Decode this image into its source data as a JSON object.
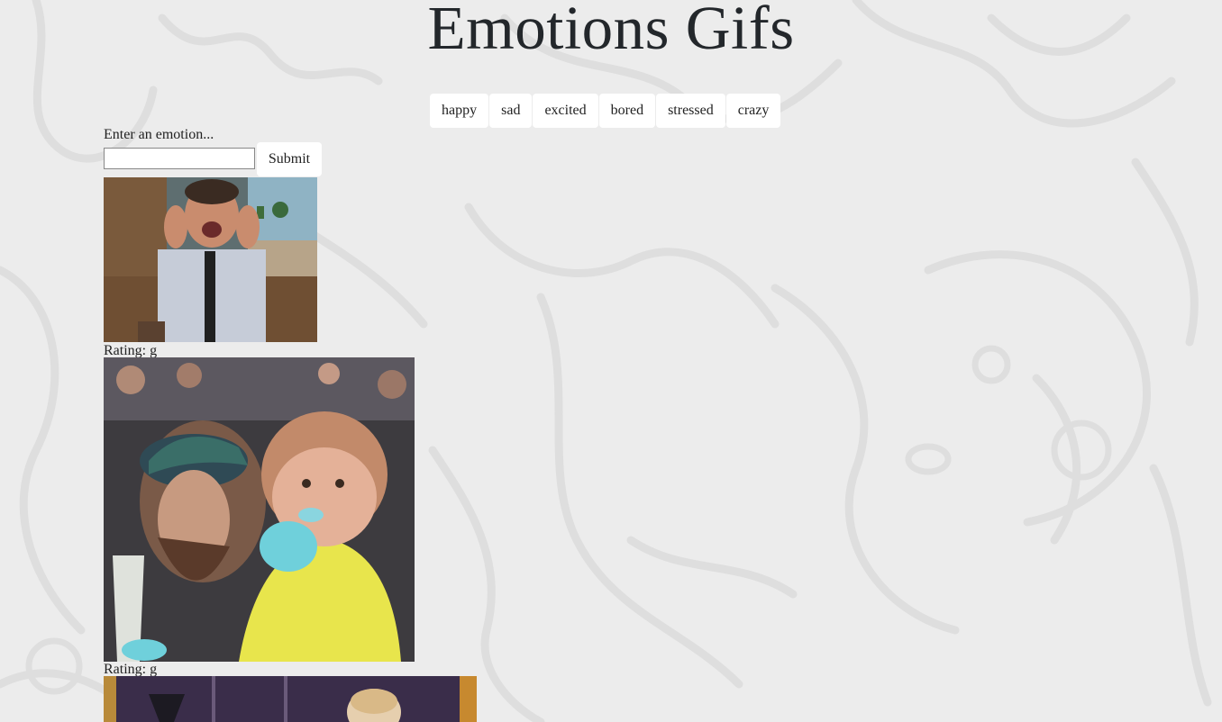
{
  "page": {
    "title": "Emotions Gifs",
    "background_color": "#ececec"
  },
  "emotion_buttons": [
    "happy",
    "sad",
    "excited",
    "bored",
    "stressed",
    "crazy"
  ],
  "form": {
    "label": "Enter an emotion...",
    "input_value": "",
    "submit_label": "Submit"
  },
  "gifs": [
    {
      "subject": "man in shirt and tie clapping excitedly in kitchen",
      "rating": "Rating: g"
    },
    {
      "subject": "little girl in yellow raincoat eating blue cotton candy at a game",
      "rating": "Rating: g"
    },
    {
      "subject": "woman on a stage (partially visible)"
    }
  ]
}
